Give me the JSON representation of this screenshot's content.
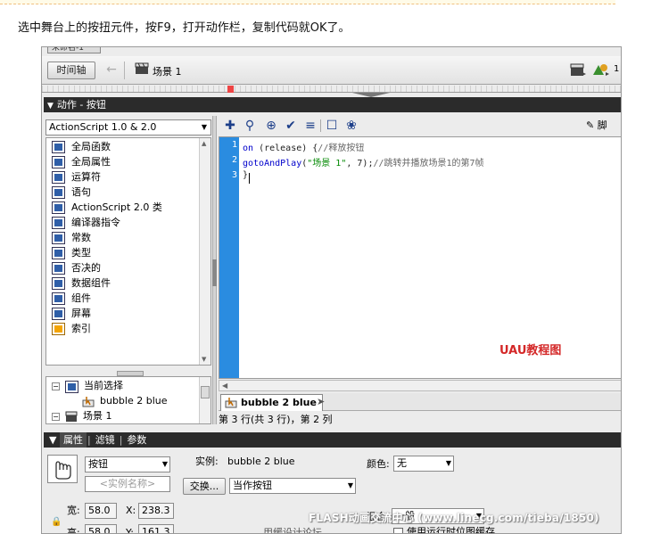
{
  "caption": "选中舞台上的按扭元件，按F9，打开动作栏，复制代码就OK了。",
  "window": {
    "title_tab": "未命名-1"
  },
  "scene_bar": {
    "timeline_button": "时间轴",
    "scene_label": "场景 1",
    "right_fragment": "1"
  },
  "actions_panel": {
    "title": "动作 - 按钮",
    "language_select": "ActionScript 1.0 & 2.0",
    "tree_items": [
      {
        "label": "全局函数",
        "icon": "book-icon"
      },
      {
        "label": "全局属性",
        "icon": "book-icon"
      },
      {
        "label": "运算符",
        "icon": "book-icon"
      },
      {
        "label": "语句",
        "icon": "book-icon"
      },
      {
        "label": "ActionScript 2.0 类",
        "icon": "book-icon"
      },
      {
        "label": "编译器指令",
        "icon": "book-icon"
      },
      {
        "label": "常数",
        "icon": "book-icon"
      },
      {
        "label": "类型",
        "icon": "book-icon"
      },
      {
        "label": "否决的",
        "icon": "book-icon"
      },
      {
        "label": "数据组件",
        "icon": "book-icon"
      },
      {
        "label": "组件",
        "icon": "book-icon"
      },
      {
        "label": "屏幕",
        "icon": "book-icon"
      },
      {
        "label": "索引",
        "icon": "index-book-icon"
      }
    ],
    "nav_tree": {
      "current_selection": "当前选择",
      "symbol_name": "bubble 2 blue",
      "scene": "场景 1"
    },
    "script_assist": "脚",
    "code": {
      "lines": [
        {
          "number": "1",
          "kw": "on",
          "rest": " (release) {",
          "comment": "//释放按钮"
        },
        {
          "number": "2",
          "kw": "gotoAndPlay",
          "rest1": "(",
          "str": "\"场景 1\"",
          "rest2": ", 7);",
          "comment": "//跳转并播放场景1的第7帧"
        },
        {
          "number": "3",
          "kw": "",
          "rest": "}",
          "comment": ""
        }
      ]
    },
    "watermark": "UAU教程图",
    "script_tab": "bubble 2 blue",
    "status": "第 3 行(共 3 行)，第 2 列"
  },
  "properties_panel": {
    "tabs": [
      "属性",
      "滤镜",
      "参数"
    ],
    "symbol_type": "按钮",
    "instance_name_placeholder": "<实例名称>",
    "instance_label": "实例:",
    "instance_value": "bubble 2 blue",
    "swap_button": "交换...",
    "track_select": "当作按钮",
    "color_label": "颜色:",
    "color_select": "无",
    "width_label": "宽:",
    "width_value": "58.0",
    "height_label": "高:",
    "height_value": "58.0",
    "x_label": "X:",
    "x_value": "238.3",
    "y_label": "Y:",
    "y_value": "161.3",
    "blend_label": "混合:",
    "blend_value": "一般",
    "bitmap_cache_label": "使用运行时位图缓存",
    "bottom_fragment": "用缓设计论坛"
  },
  "site_watermark": "FLASH动画交流中心 (www.linecg.com/tieba/1850)"
}
